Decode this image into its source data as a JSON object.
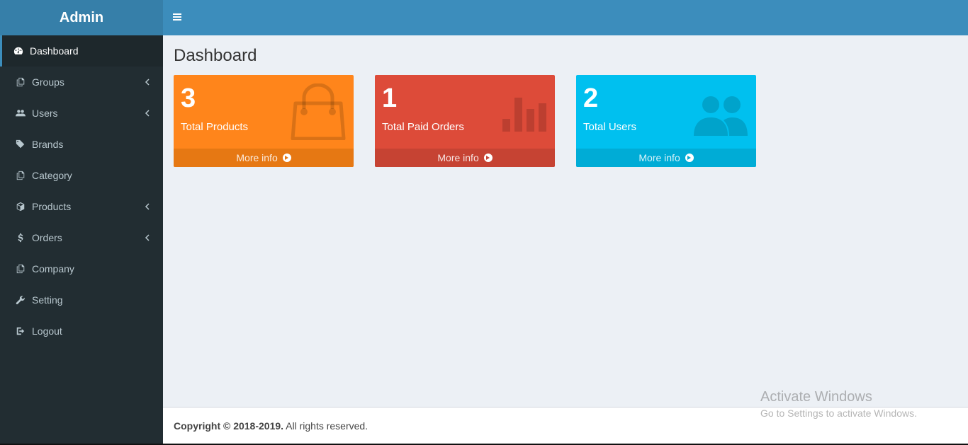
{
  "brand": {
    "title": "Admin"
  },
  "sidebar": {
    "items": [
      {
        "label": "Dashboard",
        "icon": "dashboard-icon",
        "active": true,
        "submenu": false
      },
      {
        "label": "Groups",
        "icon": "copy-icon",
        "active": false,
        "submenu": true
      },
      {
        "label": "Users",
        "icon": "users-icon",
        "active": false,
        "submenu": true
      },
      {
        "label": "Brands",
        "icon": "tags-icon",
        "active": false,
        "submenu": false
      },
      {
        "label": "Category",
        "icon": "copy-icon",
        "active": false,
        "submenu": false
      },
      {
        "label": "Products",
        "icon": "cube-icon",
        "active": false,
        "submenu": true
      },
      {
        "label": "Orders",
        "icon": "dollar-icon",
        "active": false,
        "submenu": true
      },
      {
        "label": "Company",
        "icon": "copy-icon",
        "active": false,
        "submenu": false
      },
      {
        "label": "Setting",
        "icon": "wrench-icon",
        "active": false,
        "submenu": false
      },
      {
        "label": "Logout",
        "icon": "sign-out-icon",
        "active": false,
        "submenu": false
      }
    ]
  },
  "main": {
    "title": "Dashboard",
    "boxes": [
      {
        "value": "3",
        "label": "Total Products",
        "more": "More info",
        "color": "#ff851b",
        "footer_color": "#e67813",
        "icon": "shopping-bag-icon"
      },
      {
        "value": "1",
        "label": "Total Paid Orders",
        "more": "More info",
        "color": "#dd4b39",
        "footer_color": "#c64333",
        "icon": "bar-chart-icon"
      },
      {
        "value": "2",
        "label": "Total Users",
        "more": "More info",
        "color": "#00c0ef",
        "footer_color": "#00acd6",
        "icon": "users-icon"
      }
    ]
  },
  "footer": {
    "copyright": "Copyright © 2018-2019.",
    "rights": " All rights reserved."
  },
  "watermark": {
    "line1": "Activate Windows",
    "line2": "Go to Settings to activate Windows."
  }
}
